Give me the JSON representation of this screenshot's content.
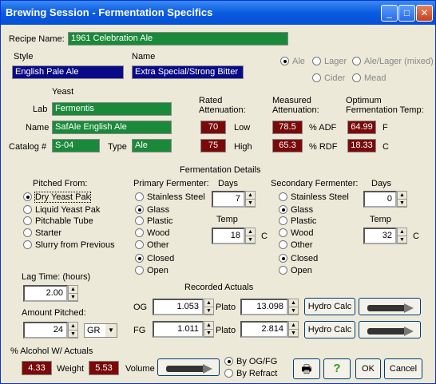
{
  "title": "Brewing Session - Fermentation Specifics",
  "controls": {
    "minimize": "_",
    "maximize": "□",
    "close": "✕"
  },
  "recipe": {
    "label": "Recipe Name:",
    "value": "1961 Celebration Ale"
  },
  "style": {
    "label": "Style",
    "value": "English Pale Ale"
  },
  "name": {
    "label": "Name",
    "value": "Extra Special/Strong Bitter"
  },
  "beer_type": [
    "Ale",
    "Lager",
    "Ale/Lager (mixed)",
    "Cider",
    "Mead"
  ],
  "yeast": {
    "header": "Yeast",
    "lab_label": "Lab",
    "lab": "Fermentis",
    "name_label": "Name",
    "name": "SafAle English Ale",
    "catalog_label": "Catalog #",
    "catalog": "S-04",
    "type_label": "Type",
    "type": "Ale"
  },
  "rated": {
    "header": "Rated Attenuation:",
    "low": "70",
    "low_label": "Low",
    "high": "75",
    "high_label": "High"
  },
  "measured": {
    "header": "Measured Attenuation:",
    "adf": "78.5",
    "adf_label": "% ADF",
    "rdf": "65.3",
    "rdf_label": "% RDF"
  },
  "optimum": {
    "header": "Optimum Fermentation Temp:",
    "f": "64.99",
    "f_label": "F",
    "c": "18.33",
    "c_label": "C"
  },
  "ferm_title": "Fermentation Details",
  "pitched": {
    "header": "Pitched From:",
    "options": [
      "Dry Yeast Pak",
      "Liquid Yeast Pak",
      "Pitchable Tube",
      "Starter",
      "Slurry from Previous"
    ]
  },
  "primary": {
    "header": "Primary Fermenter:",
    "options": [
      "Stainless Steel",
      "Glass",
      "Plastic",
      "Wood",
      "Other"
    ],
    "closed": "Closed",
    "open": "Open",
    "days_label": "Days",
    "days": "7",
    "temp_label": "Temp",
    "temp": "18",
    "unit": "C"
  },
  "secondary": {
    "header": "Secondary Fermenter:",
    "options": [
      "Stainless Steel",
      "Glass",
      "Plastic",
      "Wood",
      "Other"
    ],
    "closed": "Closed",
    "open": "Open",
    "days_label": "Days",
    "days": "0",
    "temp_label": "Temp",
    "temp": "32",
    "unit": "C"
  },
  "lag": {
    "label": "Lag Time: (hours)",
    "value": "2.00"
  },
  "amount": {
    "label": "Amount Pitched:",
    "value": "24",
    "unit": "GR"
  },
  "actuals": {
    "header": "Recorded Actuals",
    "og_label": "OG",
    "og": "1.053",
    "og_plato": "13.098",
    "fg_label": "FG",
    "fg": "1.011",
    "fg_plato": "2.814",
    "plato_label": "Plato",
    "hydro": "Hydro Calc"
  },
  "alcohol": {
    "header": "% Alcohol W/ Actuals",
    "abv": "4.33",
    "weight_label": "Weight",
    "weight": "5.53",
    "volume_label": "Volume",
    "by_og": "By OG/FG",
    "by_refract": "By Refract"
  },
  "buttons": {
    "help": "?",
    "ok": "OK",
    "cancel": "Cancel"
  }
}
